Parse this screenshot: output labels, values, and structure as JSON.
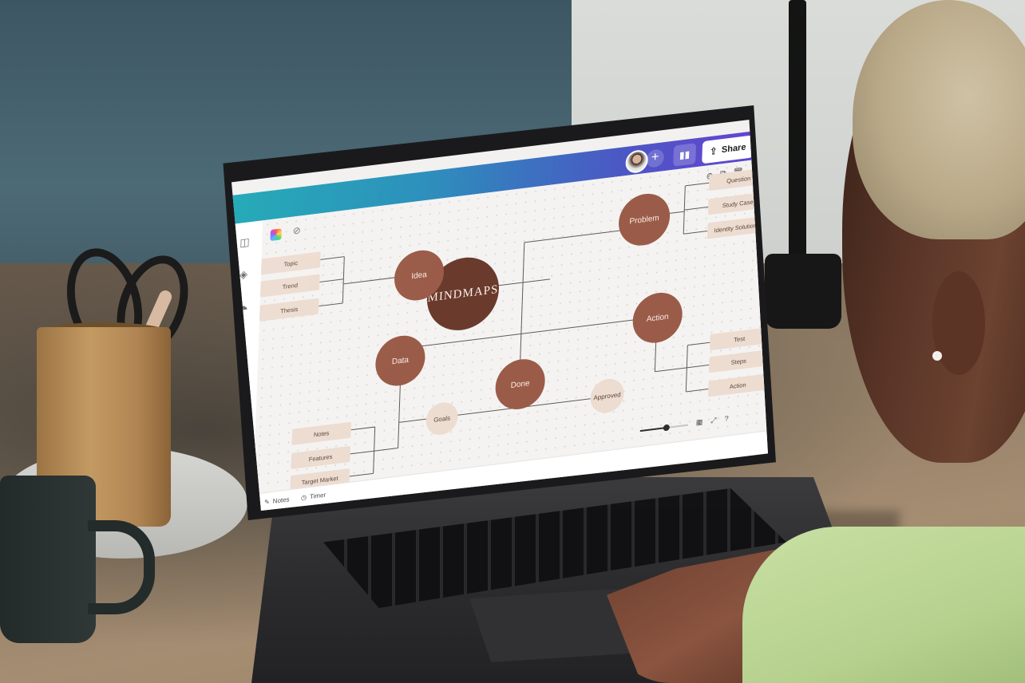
{
  "scene": {
    "colors": {
      "wall": "#4c6a76",
      "desk": "#a58d72",
      "laptop": "#2c2c2e",
      "accent_start": "#1aa7b4",
      "accent_end": "#6a3fd4",
      "node": "#9a5c48",
      "node_center": "#6a3b2d",
      "leaf": "#eddcd0"
    }
  },
  "header": {
    "add_icon": "+",
    "insights_icon": "chart-bars-icon",
    "share_label": "Share",
    "share_icon": "⇪"
  },
  "page_actions": {
    "add": "⊕",
    "duplicate": "⧉",
    "delete": "🗑"
  },
  "sidebar": {
    "items": [
      {
        "icon": "layout-icon",
        "glyph": "◫"
      },
      {
        "icon": "elements-icon",
        "glyph": "◈"
      },
      {
        "icon": "upload-cloud-icon",
        "glyph": "☁"
      },
      {
        "icon": "text-icon",
        "glyph": "T"
      },
      {
        "icon": "music-icon",
        "glyph": "♫"
      },
      {
        "icon": "video-icon",
        "glyph": "▶"
      },
      {
        "icon": "more-icon",
        "glyph": "•••"
      }
    ]
  },
  "mindmap": {
    "center": {
      "line1": "MIND",
      "line2": "MAPS"
    },
    "nodes": {
      "idea": "Idea",
      "problem": "Problem",
      "action": "Action",
      "data": "Data",
      "done": "Done",
      "goals": "Goals",
      "approved": "Approved"
    },
    "leaves": {
      "idea": [
        "Topic",
        "Trend",
        "Thesis"
      ],
      "problem": [
        "Question",
        "Study Case",
        "Identity Solutions"
      ],
      "action": [
        "Test",
        "Steps",
        "Action"
      ],
      "data": [
        "Notes",
        "Features",
        "Target Market"
      ]
    }
  },
  "footer": {
    "notes_label": "Notes",
    "timer_label": "Timer",
    "zoom_level": 0.55
  }
}
